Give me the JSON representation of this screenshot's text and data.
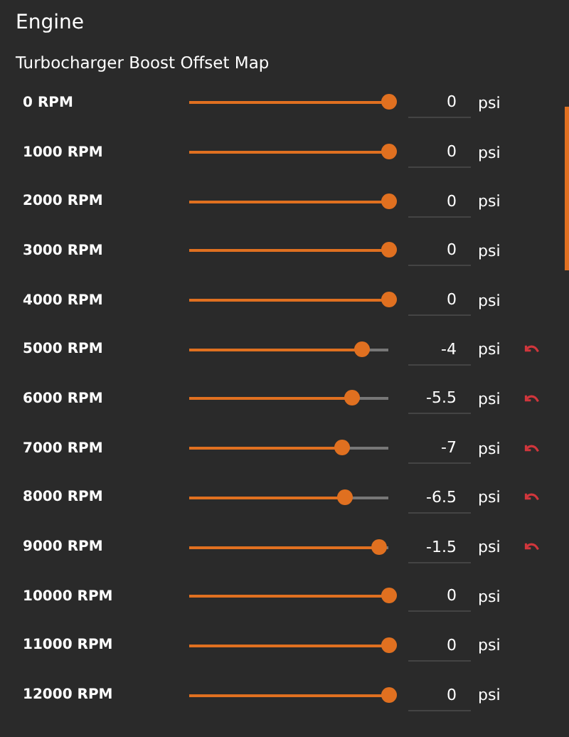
{
  "panel": {
    "title": "Engine",
    "subtitle": "Turbocharger Boost Offset Map"
  },
  "rows": [
    {
      "label": "0 RPM",
      "level": 1,
      "value": "0",
      "unit": "psi",
      "modified": false
    },
    {
      "label": "1000 RPM",
      "level": 1,
      "value": "0",
      "unit": "psi",
      "modified": false
    },
    {
      "label": "2000 RPM",
      "level": 1,
      "value": "0",
      "unit": "psi",
      "modified": false
    },
    {
      "label": "3000 RPM",
      "level": 1,
      "value": "0",
      "unit": "psi",
      "modified": false
    },
    {
      "label": "4000 RPM",
      "level": 1,
      "value": "0",
      "unit": "psi",
      "modified": false
    },
    {
      "label": "5000 RPM",
      "level": 0.867,
      "value": "-4",
      "unit": "psi",
      "modified": true
    },
    {
      "label": "6000 RPM",
      "level": 0.817,
      "value": "-5.5",
      "unit": "psi",
      "modified": true
    },
    {
      "label": "7000 RPM",
      "level": 0.767,
      "value": "-7",
      "unit": "psi",
      "modified": true
    },
    {
      "label": "8000 RPM",
      "level": 0.783,
      "value": "-6.5",
      "unit": "psi",
      "modified": true
    },
    {
      "label": "9000 RPM",
      "level": 0.95,
      "value": "-1.5",
      "unit": "psi",
      "modified": true
    },
    {
      "label": "10000 RPM",
      "level": 1,
      "value": "0",
      "unit": "psi",
      "modified": false
    },
    {
      "label": "11000 RPM",
      "level": 1,
      "value": "0",
      "unit": "psi",
      "modified": false
    },
    {
      "label": "12000 RPM",
      "level": 1,
      "value": "0",
      "unit": "psi",
      "modified": false
    }
  ]
}
